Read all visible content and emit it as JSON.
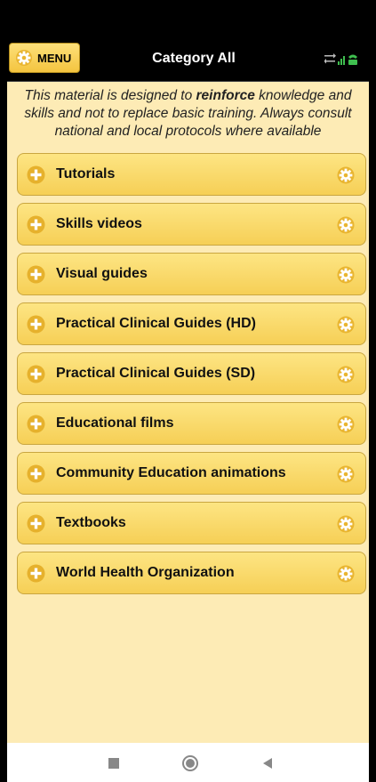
{
  "header": {
    "menu_label": "MENU",
    "title": "Category All"
  },
  "disclaimer": {
    "before": "This material is designed to ",
    "bold": "reinforce",
    "after": " knowledge and skills and not to replace basic training. Always consult national and local protocols where available"
  },
  "categories": [
    {
      "label": "Tutorials"
    },
    {
      "label": "Skills videos"
    },
    {
      "label": "Visual guides"
    },
    {
      "label": "Practical Clinical Guides (HD)"
    },
    {
      "label": "Practical Clinical Guides (SD)"
    },
    {
      "label": "Educational films"
    },
    {
      "label": "Community Education animations"
    },
    {
      "label": "Textbooks"
    },
    {
      "label": "World Health Organization"
    }
  ],
  "colors": {
    "background": "#fdebb5",
    "button": "#f6cf56",
    "header": "#000000"
  },
  "icons": {
    "menu": "gear-icon",
    "expand": "plus-icon",
    "settings": "gear-icon",
    "status": "network-signal-icon"
  }
}
